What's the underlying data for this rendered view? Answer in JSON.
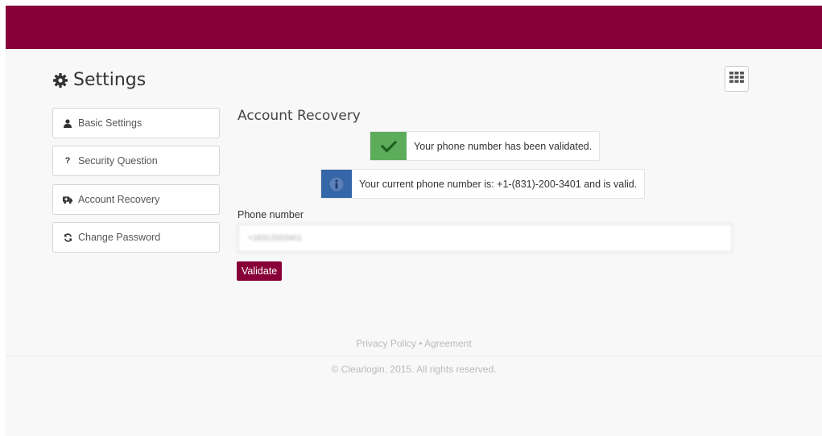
{
  "header": {
    "brand_color": "#870037"
  },
  "page": {
    "title": "Settings",
    "title_icon": "gear-icon",
    "apps_icon": "grid-icon"
  },
  "sidebar": {
    "items": [
      {
        "label": "Basic Settings",
        "icon": "user-icon"
      },
      {
        "label": "Security Question",
        "icon": "question-icon"
      },
      {
        "label": "Account Recovery",
        "icon": "ambulance-icon"
      },
      {
        "label": "Change Password",
        "icon": "refresh-icon"
      }
    ]
  },
  "main": {
    "section_title": "Account Recovery",
    "success_alert": {
      "icon": "check-icon",
      "text": "Your phone number has been validated.",
      "color": "#5cac5c"
    },
    "info_alert": {
      "icon": "info-icon",
      "text": "Your current phone number is: +1-(831)-200-3401 and is valid.",
      "color": "#3566a8"
    },
    "phone_field": {
      "label": "Phone number",
      "value": "+18312003401"
    },
    "validate_label": "Validate"
  },
  "footer": {
    "privacy": "Privacy Policy",
    "separator": "•",
    "agreement": "Agreement",
    "copyright": "© Clearlogin, 2015. All rights reserved."
  }
}
